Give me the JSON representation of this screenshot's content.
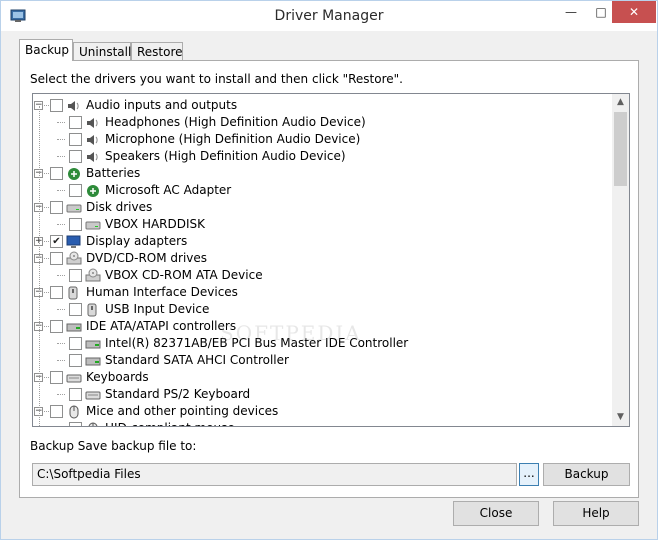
{
  "window": {
    "title": "Driver Manager",
    "min_icon": "minimize-icon",
    "max_icon": "maximize-icon",
    "close_icon": "close-icon"
  },
  "tabs": [
    {
      "label": "Backup",
      "active": true
    },
    {
      "label": "Uninstall",
      "active": false
    },
    {
      "label": "Restore",
      "active": false
    }
  ],
  "instruction": "Select the drivers you want to install and then click \"Restore\".",
  "tree": [
    {
      "label": "Audio inputs and outputs",
      "level": 0,
      "checked": false,
      "expanded": true,
      "icon": "speaker-icon"
    },
    {
      "label": "Headphones (High Definition Audio Device)",
      "level": 1,
      "checked": false,
      "icon": "speaker-icon"
    },
    {
      "label": "Microphone (High Definition Audio Device)",
      "level": 1,
      "checked": false,
      "icon": "speaker-icon"
    },
    {
      "label": "Speakers (High Definition Audio Device)",
      "level": 1,
      "checked": false,
      "icon": "speaker-icon"
    },
    {
      "label": "Batteries",
      "level": 0,
      "checked": false,
      "expanded": true,
      "icon": "battery-icon"
    },
    {
      "label": "Microsoft AC Adapter",
      "level": 1,
      "checked": false,
      "icon": "battery-icon"
    },
    {
      "label": "Disk drives",
      "level": 0,
      "checked": false,
      "expanded": true,
      "icon": "disk-drive-icon"
    },
    {
      "label": "VBOX HARDDISK",
      "level": 1,
      "checked": false,
      "icon": "disk-drive-icon"
    },
    {
      "label": "Display adapters",
      "level": 0,
      "checked": true,
      "expanded": false,
      "icon": "display-adapter-icon"
    },
    {
      "label": "DVD/CD-ROM drives",
      "level": 0,
      "checked": false,
      "expanded": true,
      "icon": "cdrom-drive-icon"
    },
    {
      "label": "VBOX CD-ROM ATA Device",
      "level": 1,
      "checked": false,
      "icon": "cdrom-drive-icon"
    },
    {
      "label": "Human Interface Devices",
      "level": 0,
      "checked": false,
      "expanded": true,
      "icon": "hid-icon"
    },
    {
      "label": "USB Input Device",
      "level": 1,
      "checked": false,
      "icon": "hid-icon"
    },
    {
      "label": "IDE ATA/ATAPI controllers",
      "level": 0,
      "checked": false,
      "expanded": true,
      "icon": "ide-controller-icon"
    },
    {
      "label": "Intel(R) 82371AB/EB PCI Bus Master IDE Controller",
      "level": 1,
      "checked": false,
      "icon": "ide-controller-icon"
    },
    {
      "label": "Standard SATA AHCI Controller",
      "level": 1,
      "checked": false,
      "icon": "ide-controller-icon"
    },
    {
      "label": "Keyboards",
      "level": 0,
      "checked": false,
      "expanded": true,
      "icon": "keyboard-icon"
    },
    {
      "label": "Standard PS/2 Keyboard",
      "level": 1,
      "checked": false,
      "icon": "keyboard-icon"
    },
    {
      "label": "Mice and other pointing devices",
      "level": 0,
      "checked": false,
      "expanded": true,
      "icon": "mouse-icon"
    },
    {
      "label": "HID-compliant mouse",
      "level": 1,
      "checked": false,
      "icon": "mouse-icon"
    }
  ],
  "backup": {
    "save_label": "Backup Save backup file to:",
    "path_value": "C:\\Softpedia Files",
    "browse_label": "...",
    "backup_button": "Backup"
  },
  "footer": {
    "close_button": "Close",
    "help_button": "Help"
  },
  "scrollbar": {
    "up_icon": "scroll-up-icon",
    "down_icon": "scroll-down-icon"
  }
}
